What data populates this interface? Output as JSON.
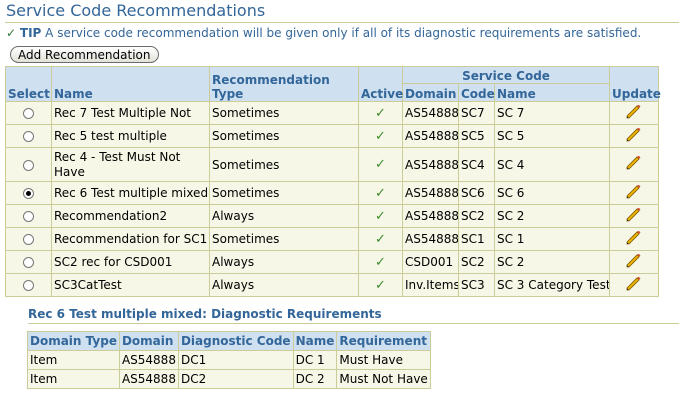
{
  "page": {
    "title": "Service Code Recommendations",
    "tip_label": "TIP",
    "tip_text": "A service code recommendation will be given only if all of its diagnostic requirements are satisfied."
  },
  "toolbar": {
    "add_label": "Add Recommendation"
  },
  "table": {
    "headers": {
      "select": "Select",
      "name": "Name",
      "rec_type": "Recommendation Type",
      "active": "Active",
      "service_code_group": "Service Code",
      "domain": "Domain",
      "code": "Code",
      "sc_name": "Name",
      "update": "Update"
    },
    "rows": [
      {
        "name": "Rec 7 Test Multiple Not",
        "type": "Sometimes",
        "domain": "AS54888",
        "code": "SC7",
        "sc_name": "SC 7",
        "selected": false
      },
      {
        "name": "Rec 5 test multiple",
        "type": "Sometimes",
        "domain": "AS54888",
        "code": "SC5",
        "sc_name": "SC 5",
        "selected": false
      },
      {
        "name": "Rec 4 - Test Must Not Have",
        "type": "Sometimes",
        "domain": "AS54888",
        "code": "SC4",
        "sc_name": "SC 4",
        "selected": false
      },
      {
        "name": "Rec 6 Test multiple mixed",
        "type": "Sometimes",
        "domain": "AS54888",
        "code": "SC6",
        "sc_name": "SC 6",
        "selected": true
      },
      {
        "name": "Recommendation2",
        "type": "Always",
        "domain": "AS54888",
        "code": "SC2",
        "sc_name": "SC 2",
        "selected": false
      },
      {
        "name": "Recommendation for SC1",
        "type": "Sometimes",
        "domain": "AS54888",
        "code": "SC1",
        "sc_name": "SC 1",
        "selected": false
      },
      {
        "name": "SC2 rec for CSD001",
        "type": "Always",
        "domain": "CSD001",
        "code": "SC2",
        "sc_name": "SC 2",
        "selected": false
      },
      {
        "name": "SC3CatTest",
        "type": "Always",
        "domain": "Inv.Items",
        "code": "SC3",
        "sc_name": "SC 3 Category Test",
        "selected": false
      }
    ]
  },
  "requirements": {
    "title": "Rec 6 Test multiple mixed: Diagnostic Requirements",
    "headers": {
      "domain_type": "Domain Type",
      "domain": "Domain",
      "diag_code": "Diagnostic Code",
      "name": "Name",
      "requirement": "Requirement"
    },
    "rows": [
      {
        "domain_type": "Item",
        "domain": "AS54888",
        "diag_code": "DC1",
        "name": "DC 1",
        "requirement": "Must Have"
      },
      {
        "domain_type": "Item",
        "domain": "AS54888",
        "diag_code": "DC2",
        "name": "DC 2",
        "requirement": "Must Not Have"
      }
    ]
  },
  "colors": {
    "title": "#336699",
    "header_bg": "#cfe0f1",
    "row_bg": "#f7f7e7",
    "border": "#cccc99",
    "check": "#3a8a2a"
  },
  "icons": {
    "active": "check-icon",
    "update": "pencil-icon",
    "tip": "tip-check-icon"
  }
}
